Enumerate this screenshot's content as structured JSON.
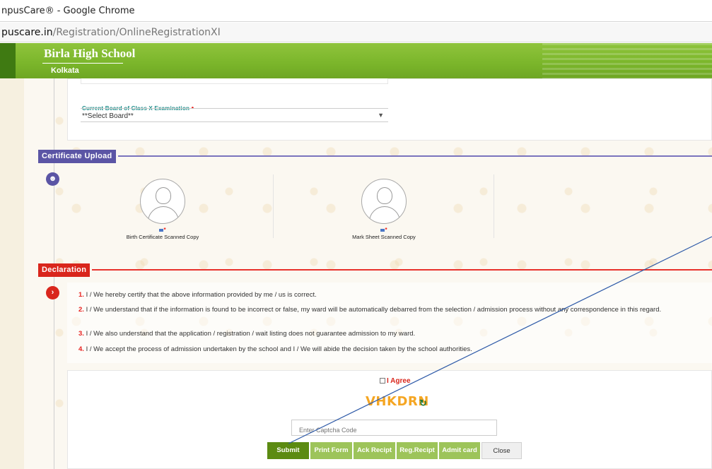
{
  "browser": {
    "window_title": "npusCare® - Google Chrome",
    "url_host": "puscare.in",
    "url_path": "/Registration/OnlineRegistrationXI"
  },
  "header": {
    "school_name": "Birla High School",
    "city": "Kolkata"
  },
  "board": {
    "label": "Current Board of Class X Examination",
    "required_mark": "•",
    "selected": "**Select Board**",
    "arrow": "▼"
  },
  "certificate_upload": {
    "title": "Certificate Upload",
    "icon": "user-circle-icon",
    "items": [
      {
        "label": "Birth Certificate Scanned Copy",
        "mark": "*"
      },
      {
        "label": "Mark Sheet Scanned Copy",
        "mark": "*"
      }
    ]
  },
  "declaration": {
    "title": "Declaration",
    "icon": "chevron-right-circle-icon",
    "items": [
      {
        "num": "1.",
        "text": "I / We hereby certify that the above information provided by me / us is correct."
      },
      {
        "num": "2.",
        "text": "I / We understand that if the information is found to be incorrect or false, my ward will be automatically debarred from the selection / admission process without any correspondence in this regard."
      },
      {
        "num": "3.",
        "text": "I / We also understand that the application / registration / wait listing does not guarantee admission to my ward."
      },
      {
        "num": "4.",
        "text": "I / We accept the process of admission undertaken by the school and I / We will abide the decision taken by the school authorities."
      }
    ]
  },
  "agreement": {
    "agree_label": "I Agree"
  },
  "captcha": {
    "code": "VHKDRN",
    "refresh_icon": "↻",
    "placeholder": "Enter Captcha Code"
  },
  "buttons": {
    "submit": "Submit",
    "print_form": "Print Form",
    "ack_receipt": "Ack Recipt",
    "reg_receipt": "Reg.Recipt",
    "admit_card": "Admit card",
    "close": "Close"
  },
  "colors": {
    "header_green": "#7ab52a",
    "certificate_tag": "#5b55a5",
    "declaration_tag": "#d9261c",
    "submit_green": "#5c8b12",
    "secondary_button_green": "#9dc45a",
    "captcha_orange": "#f5a623"
  }
}
